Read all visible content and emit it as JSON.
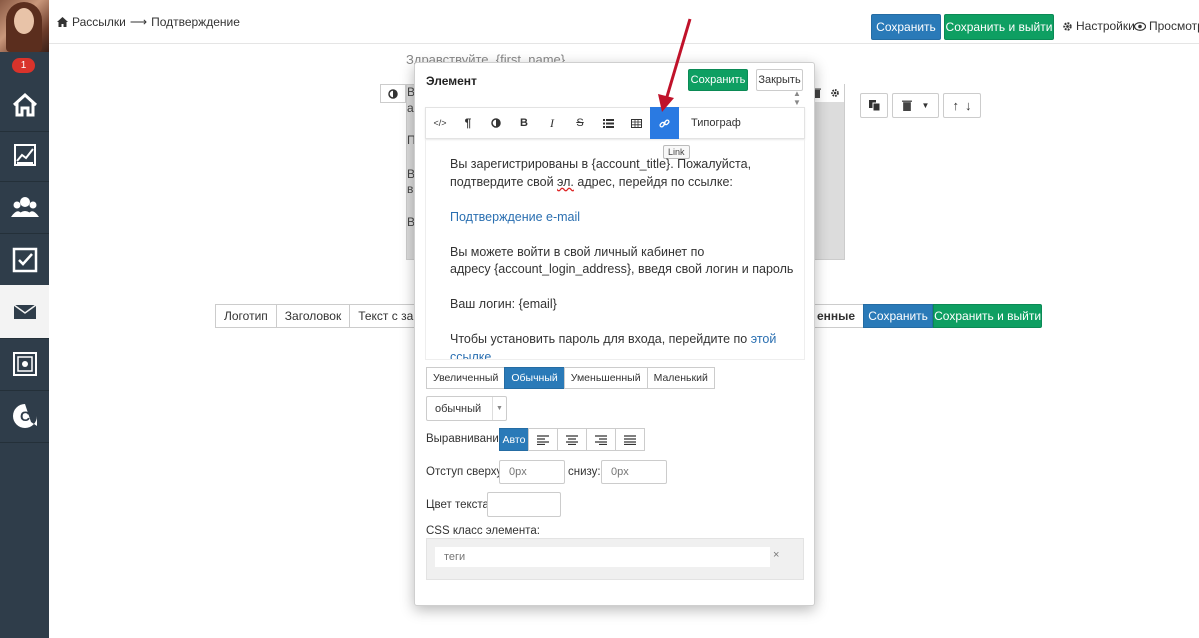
{
  "sidebar": {
    "notification_count": "1",
    "items": [
      {
        "name": "home-icon"
      },
      {
        "name": "chart-icon"
      },
      {
        "name": "users-icon"
      },
      {
        "name": "check-icon"
      },
      {
        "name": "mail-icon"
      },
      {
        "name": "safe-icon"
      },
      {
        "name": "logo-c-icon"
      }
    ]
  },
  "topbar": {
    "breadcrumb_root": "Рассылки",
    "breadcrumb_arrow": "⟶",
    "breadcrumb_current": "Подтверждение",
    "save": "Сохранить",
    "save_exit": "Сохранить и выйти",
    "settings": "Настройки",
    "preview": "Просмотр"
  },
  "background": {
    "greeting": "Здравствуйте, {first_name}",
    "letters": [
      "В",
      "а",
      "П",
      "В",
      "в",
      "В"
    ],
    "blocks_tabs": [
      "Логотип",
      "Заголовок",
      "Текст с заголо"
    ],
    "blocks_hidden_tab": "енные",
    "blocks_save": "Сохранить",
    "blocks_save_exit": "Сохранить и выйти"
  },
  "modal": {
    "title": "Элемент",
    "save": "Сохранить",
    "close": "Закрыть",
    "toolbar": {
      "buttons": [
        "code-icon",
        "paragraph-icon",
        "contrast-icon",
        "bold-icon",
        "italic-icon",
        "strikethrough-icon",
        "list-icon",
        "table-icon",
        "link-icon"
      ],
      "typograph": "Типограф",
      "tooltip": "Link"
    },
    "body": {
      "p1_a": "Вы зарегистрированы в {account_title}. Пожалуйста,",
      "p1_b_pre": "подтвердите свой ",
      "p1_b_spell": "эл.",
      "p1_b_post": " адрес, перейдя по ссылке:",
      "link_confirm": "Подтверждение e-mail",
      "p2_a": "Вы можете войти в свой личный кабинет по",
      "p2_b": "адресу {account_login_address}, введя свой логин и пароль",
      "p3": "Ваш логин: {email}",
      "p4_pre": "Чтобы установить пароль для входа, перейдите по ",
      "p4_link": "этой ссылке"
    },
    "size_options": [
      "Увеличенный",
      "Обычный",
      "Уменьшенный",
      "Маленький"
    ],
    "size_selected": "Обычный",
    "style_select": "обычный",
    "align_label": "Выравнивание",
    "align_auto": "Авто",
    "pad_top_label": "Отступ сверху:",
    "pad_top_placeholder": "0px",
    "pad_bottom_label": "снизу:",
    "pad_bottom_placeholder": "0px",
    "color_label": "Цвет текста:",
    "css_label": "CSS класс элемента:",
    "css_placeholder": "теги",
    "css_clear": "×"
  },
  "colors": {
    "sidebar_bg": "#2f3d4a",
    "primary_blue": "#2a7ab8",
    "success_green": "#0e9f62",
    "toolbar_active": "#2a7ae2",
    "annotation_arrow": "#c0122a"
  }
}
